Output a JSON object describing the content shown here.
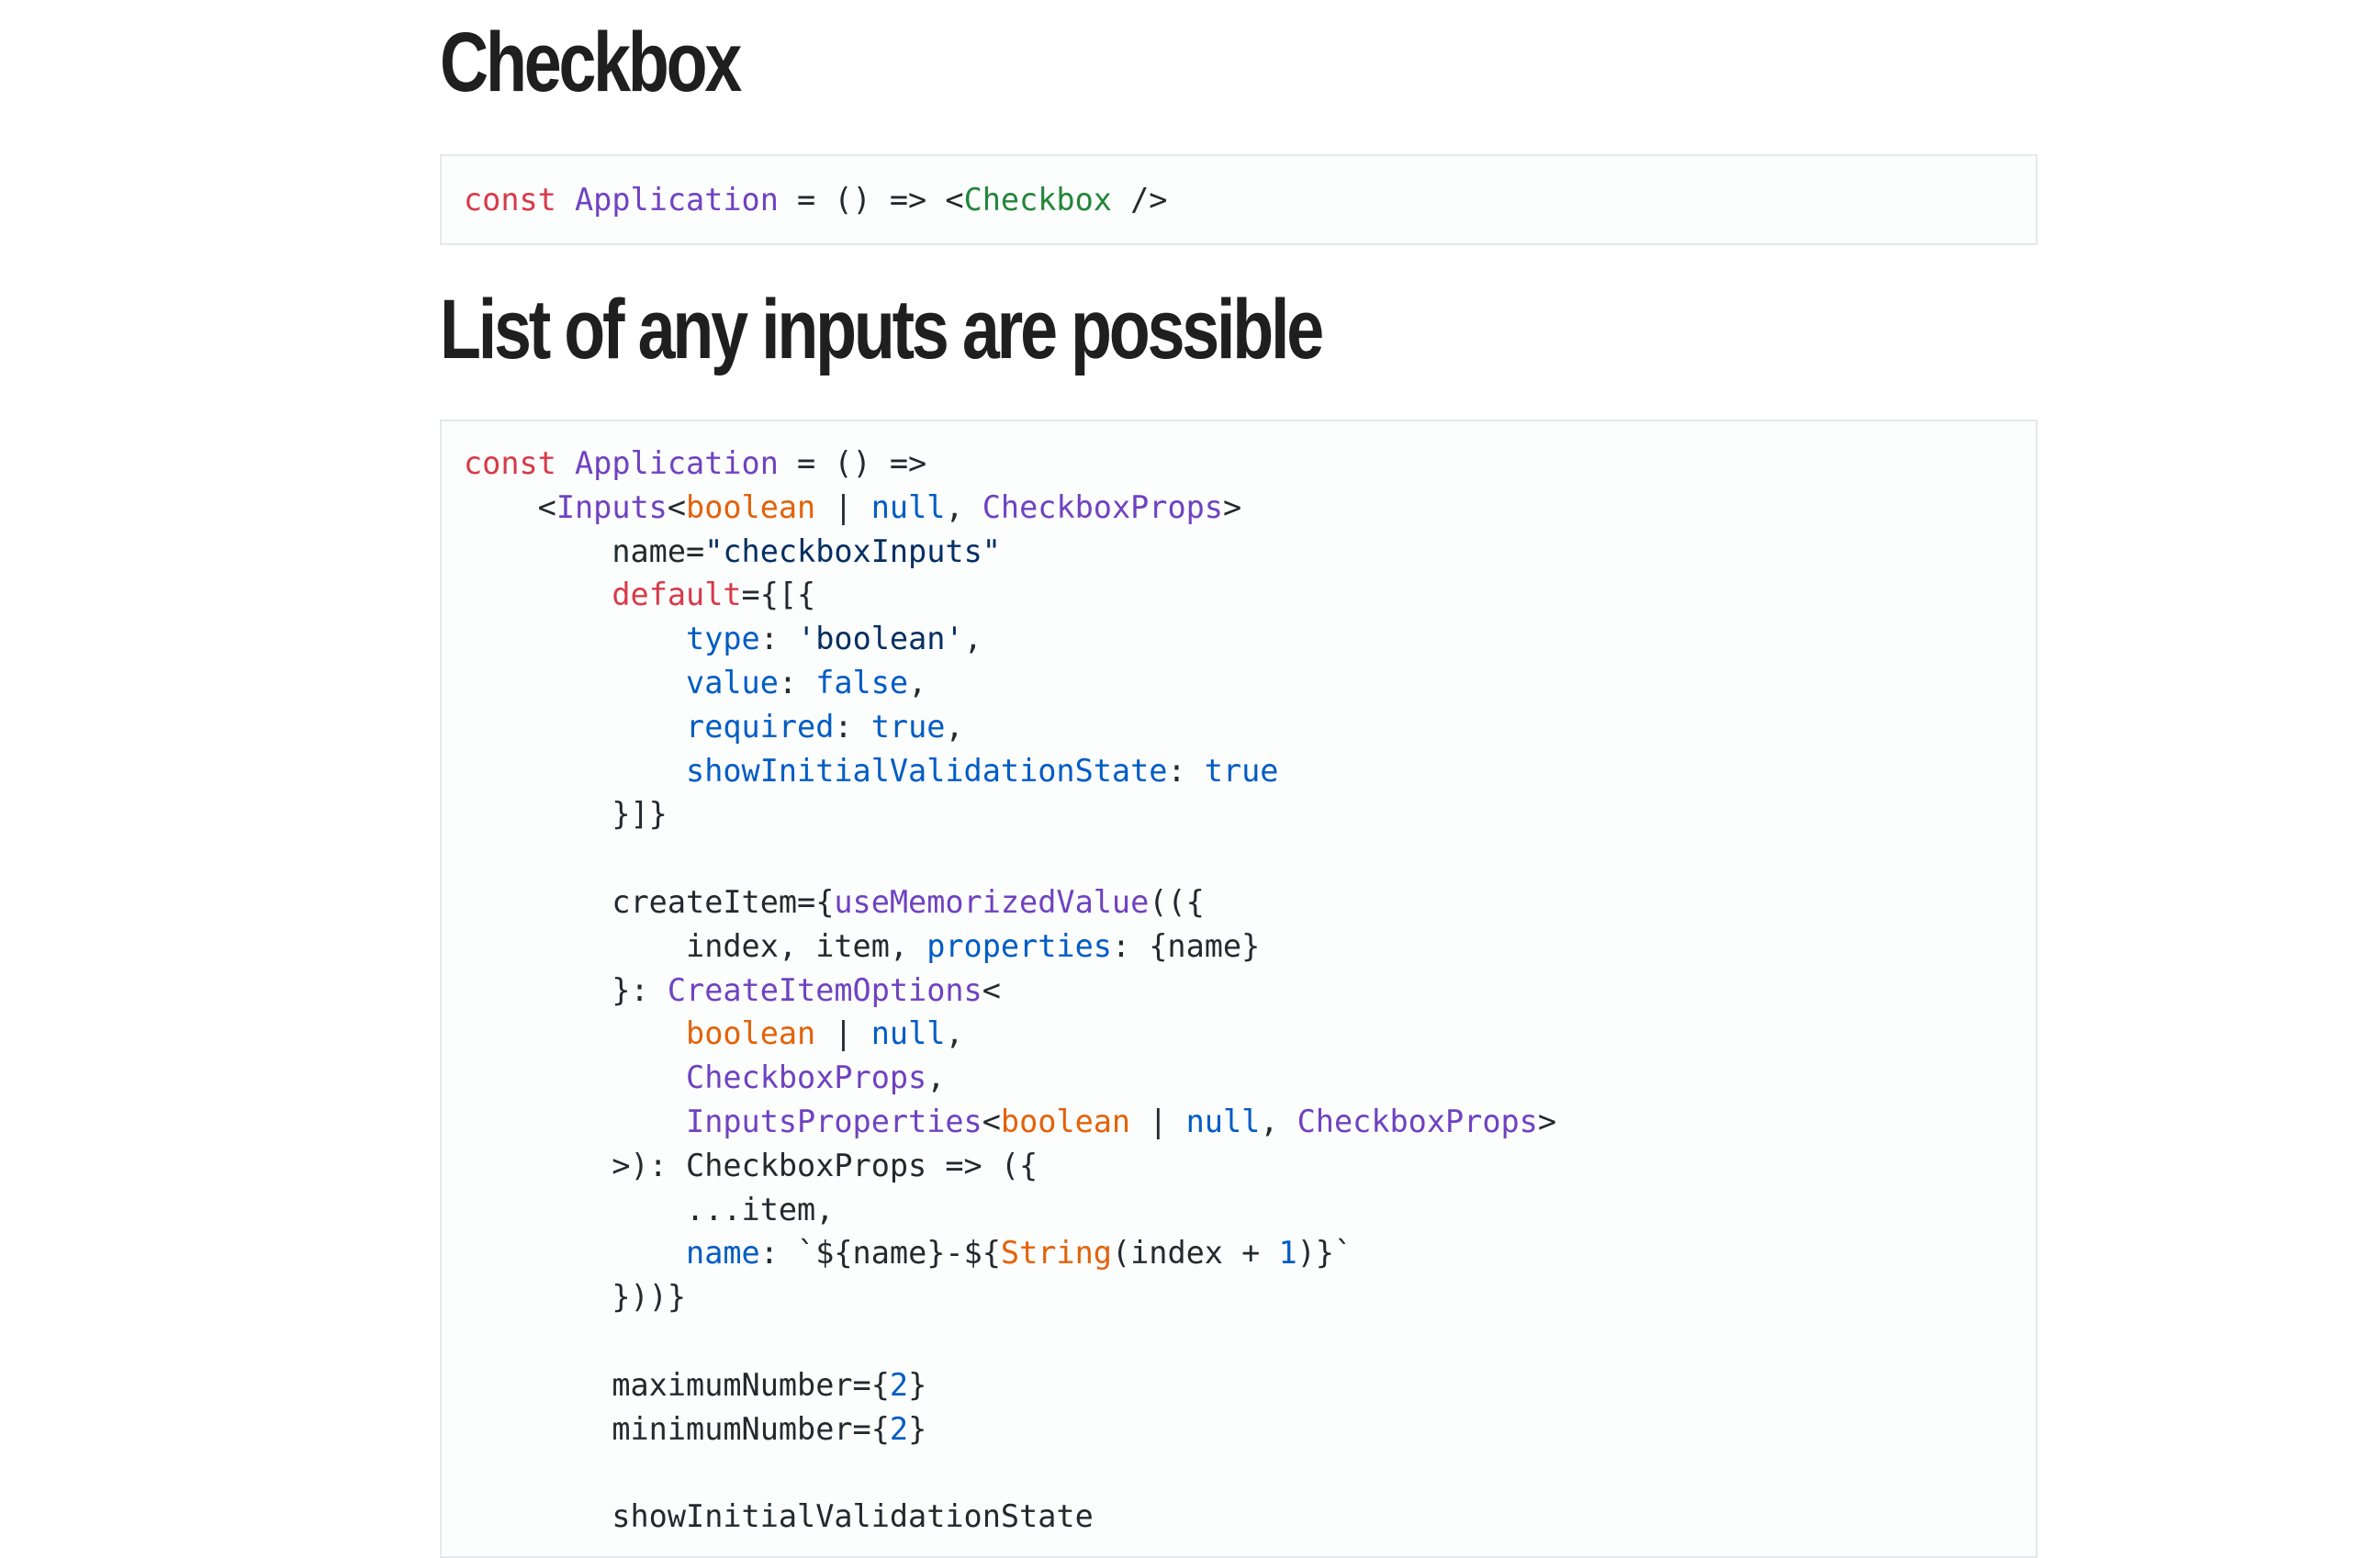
{
  "headings": {
    "checkbox": "Checkbox",
    "list": "List of any inputs are possible"
  },
  "code1": {
    "lines": [
      [
        [
          "kw",
          "const"
        ],
        [
          "",
          " "
        ],
        [
          "fn",
          "Application"
        ],
        [
          "",
          " = () => <"
        ],
        [
          "tg",
          "Checkbox"
        ],
        [
          "",
          " />"
        ]
      ]
    ]
  },
  "code2": {
    "lines": [
      [
        [
          "kw",
          "const"
        ],
        [
          "",
          " "
        ],
        [
          "fn",
          "Application"
        ],
        [
          "",
          " = () =>"
        ]
      ],
      [
        [
          "",
          "    <"
        ],
        [
          "fn",
          "Inputs"
        ],
        [
          "",
          "<"
        ],
        [
          "ty",
          "boolean"
        ],
        [
          "",
          " | "
        ],
        [
          "bl",
          "null"
        ],
        [
          "",
          ", "
        ],
        [
          "fn",
          "CheckboxProps"
        ],
        [
          "",
          ">"
        ]
      ],
      [
        [
          "",
          "        name="
        ],
        [
          "st",
          "\"checkboxInputs\""
        ]
      ],
      [
        [
          "",
          "        "
        ],
        [
          "kw",
          "default"
        ],
        [
          "",
          "={[{"
        ]
      ],
      [
        [
          "",
          "            "
        ],
        [
          "bl",
          "type"
        ],
        [
          "",
          ": "
        ],
        [
          "st",
          "'boolean'"
        ],
        [
          "",
          ","
        ]
      ],
      [
        [
          "",
          "            "
        ],
        [
          "bl",
          "value"
        ],
        [
          "",
          ": "
        ],
        [
          "bl",
          "false"
        ],
        [
          "",
          ","
        ]
      ],
      [
        [
          "",
          "            "
        ],
        [
          "bl",
          "required"
        ],
        [
          "",
          ": "
        ],
        [
          "bl",
          "true"
        ],
        [
          "",
          ","
        ]
      ],
      [
        [
          "",
          "            "
        ],
        [
          "bl",
          "showInitialValidationState"
        ],
        [
          "",
          ": "
        ],
        [
          "bl",
          "true"
        ]
      ],
      [
        [
          "",
          "        }]}"
        ]
      ],
      [
        [
          "",
          ""
        ]
      ],
      [
        [
          "",
          "        createItem={"
        ],
        [
          "fn",
          "useMemorizedValue"
        ],
        [
          "",
          "(({"
        ]
      ],
      [
        [
          "",
          "            index, item, "
        ],
        [
          "bl",
          "properties"
        ],
        [
          "",
          ": {name}"
        ]
      ],
      [
        [
          "",
          "        }: "
        ],
        [
          "fn",
          "CreateItemOptions"
        ],
        [
          "",
          "<"
        ]
      ],
      [
        [
          "",
          "            "
        ],
        [
          "ty",
          "boolean"
        ],
        [
          "",
          " | "
        ],
        [
          "bl",
          "null"
        ],
        [
          "",
          ","
        ]
      ],
      [
        [
          "",
          "            "
        ],
        [
          "fn",
          "CheckboxProps"
        ],
        [
          "",
          ","
        ]
      ],
      [
        [
          "",
          "            "
        ],
        [
          "fn",
          "InputsProperties"
        ],
        [
          "",
          "<"
        ],
        [
          "ty",
          "boolean"
        ],
        [
          "",
          " | "
        ],
        [
          "bl",
          "null"
        ],
        [
          "",
          ", "
        ],
        [
          "fn",
          "CheckboxProps"
        ],
        [
          "",
          ">"
        ]
      ],
      [
        [
          "",
          "        >): CheckboxProps => ({"
        ]
      ],
      [
        [
          "",
          "            ...item,"
        ]
      ],
      [
        [
          "",
          "            "
        ],
        [
          "bl",
          "name"
        ],
        [
          "",
          ": `${name}-${"
        ],
        [
          "ty",
          "String"
        ],
        [
          "",
          "(index + "
        ],
        [
          "bl",
          "1"
        ],
        [
          "",
          ")}`"
        ]
      ],
      [
        [
          "",
          "        }))}"
        ]
      ],
      [
        [
          "",
          ""
        ]
      ],
      [
        [
          "",
          "        maximumNumber={"
        ],
        [
          "bl",
          "2"
        ],
        [
          "",
          "}"
        ]
      ],
      [
        [
          "",
          "        minimumNumber={"
        ],
        [
          "bl",
          "2"
        ],
        [
          "",
          "}"
        ]
      ],
      [
        [
          "",
          ""
        ]
      ],
      [
        [
          "",
          "        showInitialValidationState"
        ]
      ]
    ]
  },
  "colors": {
    "keyword": "#d73a49",
    "function": "#6f42c1",
    "tag": "#22863a",
    "type": "#e36209",
    "literal": "#005cc5",
    "string": "#032f62",
    "text": "#24292e",
    "border": "#e6e8ea"
  }
}
